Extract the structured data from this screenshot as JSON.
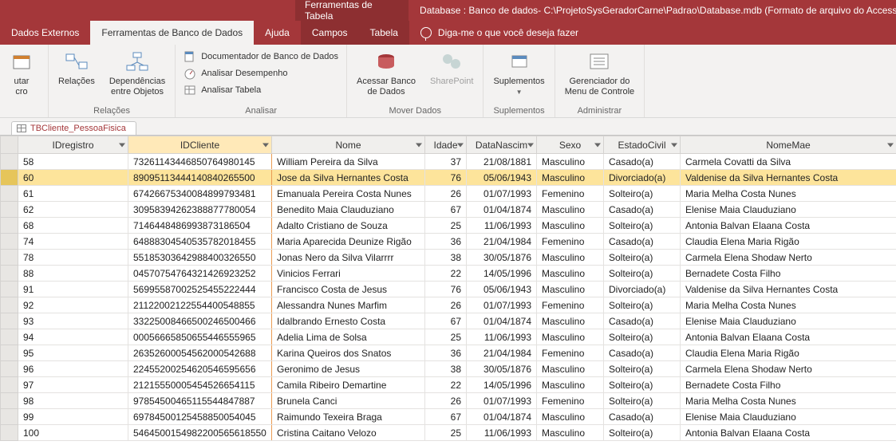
{
  "title": {
    "tools": "Ferramentas de Tabela",
    "db": "Database : Banco de dados- C:\\ProjetoSysGeradorCarne\\Padrao\\Database.mdb (Formato de arquivo do Access..."
  },
  "menu": {
    "dados_externos": "Dados Externos",
    "ferramentas_bd": "Ferramentas de Banco de Dados",
    "ajuda": "Ajuda",
    "campos": "Campos",
    "tabela": "Tabela",
    "tellme": "Diga-me o que você deseja fazer"
  },
  "ribbon": {
    "utar_cro": "utar\ncro",
    "relacoes": "Relações",
    "dependencias": "Dependências\nentre Objetos",
    "grp_relacoes": "Relações",
    "documentador": "Documentador de Banco de Dados",
    "desempenho": "Analisar Desempenho",
    "tabela": "Analisar Tabela",
    "grp_analisar": "Analisar",
    "acessar_bd": "Acessar Banco\nde Dados",
    "sharepoint": "SharePoint",
    "grp_mover": "Mover Dados",
    "suplementos": "Suplementos",
    "grp_supl": "Suplementos",
    "gerenciador": "Gerenciador do\nMenu de Controle",
    "grp_admin": "Administrar"
  },
  "tab_name": "TBCliente_PessoaFisica",
  "columns": {
    "idreg": "IDregistro",
    "idcli": "IDCliente",
    "nome": "Nome",
    "idade": "Idade",
    "data": "DataNascim",
    "sexo": "Sexo",
    "ec": "EstadoCivil",
    "nm": "NomeMae"
  },
  "rows": [
    {
      "idreg": "58",
      "idcli": "7326114344685076498014​5",
      "nome": "William Pereira da Silva",
      "idade": "37",
      "data": "21/08/1881",
      "sexo": "Masculino",
      "ec": "Casado(a)",
      "nm": "Carmela Covatti  da Silva",
      "sel": false
    },
    {
      "idreg": "60",
      "idcli": "8909511344414084026550​0",
      "nome": "Jose da Silva Hernantes Costa",
      "idade": "76",
      "data": "05/06/1943",
      "sexo": "Masculino",
      "ec": "Divorciado(a)",
      "nm": "Valdenise da Silva Hernantes Costa",
      "sel": true
    },
    {
      "idreg": "61",
      "idcli": "6742667534008489979348​1",
      "nome": "Emanuala Pereira Costa Nunes",
      "idade": "26",
      "data": "01/07/1993",
      "sexo": "Femenino",
      "ec": "Solteiro(a)",
      "nm": "Maria Melha Costa Nunes",
      "sel": false
    },
    {
      "idreg": "62",
      "idcli": "3095839426238887778005​4",
      "nome": "Benedito Maia Clauduziano",
      "idade": "67",
      "data": "01/04/1874",
      "sexo": "Masculino",
      "ec": "Casado(a)",
      "nm": "Elenise Maia Clauduziano",
      "sel": false
    },
    {
      "idreg": "68",
      "idcli": "7146448486993873186504",
      "nome": "Adalto Cristiano de Souza",
      "idade": "25",
      "data": "11/06/1993",
      "sexo": "Masculino",
      "ec": "Solteiro(a)",
      "nm": "Antonia Balvan Elaana Costa",
      "sel": false
    },
    {
      "idreg": "74",
      "idcli": "6488830454053578201845​5",
      "nome": "Maria Aparecida Deunize Rigão",
      "idade": "36",
      "data": "21/04/1984",
      "sexo": "Femenino",
      "ec": "Casado(a)",
      "nm": "Claudia Elena Maria Rigão",
      "sel": false
    },
    {
      "idreg": "78",
      "idcli": "5518530364298840032655​0",
      "nome": "Jonas Nero da Silva Vilarrrr",
      "idade": "38",
      "data": "30/05/1876",
      "sexo": "Masculino",
      "ec": "Solteiro(a)",
      "nm": "Carmela Elena Shodaw Nerto",
      "sel": false
    },
    {
      "idreg": "88",
      "idcli": "0457075476432142692325​2",
      "nome": "Vinicios Ferrari",
      "idade": "22",
      "data": "14/05/1996",
      "sexo": "Masculino",
      "ec": "Solteiro(a)",
      "nm": "Bernadete Costa Filho",
      "sel": false
    },
    {
      "idreg": "91",
      "idcli": "5699558700252545522244​4",
      "nome": "Francisco Costa de Jesus",
      "idade": "76",
      "data": "05/06/1943",
      "sexo": "Masculino",
      "ec": "Divorciado(a)",
      "nm": "Valdenise da Silva Hernantes Costa",
      "sel": false
    },
    {
      "idreg": "92",
      "idcli": "2112200212255440054885​5",
      "nome": "Alessandra Nunes Marfim",
      "idade": "26",
      "data": "01/07/1993",
      "sexo": "Femenino",
      "ec": "Solteiro(a)",
      "nm": "Maria Melha Costa Nunes",
      "sel": false
    },
    {
      "idreg": "93",
      "idcli": "3322500846650024650046​6",
      "nome": "Idalbrando Ernesto Costa",
      "idade": "67",
      "data": "01/04/1874",
      "sexo": "Masculino",
      "ec": "Casado(a)",
      "nm": "Elenise Maia Clauduziano",
      "sel": false
    },
    {
      "idreg": "94",
      "idcli": "0005666585065544655596​5",
      "nome": "Adelia Lima de Solsa",
      "idade": "25",
      "data": "11/06/1993",
      "sexo": "Masculino",
      "ec": "Solteiro(a)",
      "nm": "Antonia Balvan Elaana Costa",
      "sel": false
    },
    {
      "idreg": "95",
      "idcli": "2635260005456200054268​8",
      "nome": "Karina Queiros dos Snatos",
      "idade": "36",
      "data": "21/04/1984",
      "sexo": "Femenino",
      "ec": "Casado(a)",
      "nm": "Claudia Elena Maria Rigão",
      "sel": false
    },
    {
      "idreg": "96",
      "idcli": "2245520025462054659565​6",
      "nome": "Geronimo de Jesus",
      "idade": "38",
      "data": "30/05/1876",
      "sexo": "Masculino",
      "ec": "Solteiro(a)",
      "nm": "Carmela Elena Shodaw Nerto",
      "sel": false
    },
    {
      "idreg": "97",
      "idcli": "2121555000545452665411​5",
      "nome": "Camila Ribeiro Demartine",
      "idade": "22",
      "data": "14/05/1996",
      "sexo": "Masculino",
      "ec": "Solteiro(a)",
      "nm": "Bernadete Costa Filho",
      "sel": false
    },
    {
      "idreg": "98",
      "idcli": "9785450046511554484788​7",
      "nome": "Brunela Canci",
      "idade": "26",
      "data": "01/07/1993",
      "sexo": "Femenino",
      "ec": "Solteiro(a)",
      "nm": "Maria Melha Costa Nunes",
      "sel": false
    },
    {
      "idreg": "99",
      "idcli": "6978450012545885005404​5",
      "nome": "Raimundo Texeira Braga",
      "idade": "67",
      "data": "01/04/1874",
      "sexo": "Masculino",
      "ec": "Casado(a)",
      "nm": "Elenise Maia Clauduziano",
      "sel": false
    },
    {
      "idreg": "100",
      "idcli": "5464500154982200565618​550",
      "nome": "Cristina Caitano Velozo",
      "idade": "25",
      "data": "11/06/1993",
      "sexo": "Masculino",
      "ec": "Solteiro(a)",
      "nm": "Antonia Balvan Elaana Costa",
      "sel": false
    }
  ]
}
